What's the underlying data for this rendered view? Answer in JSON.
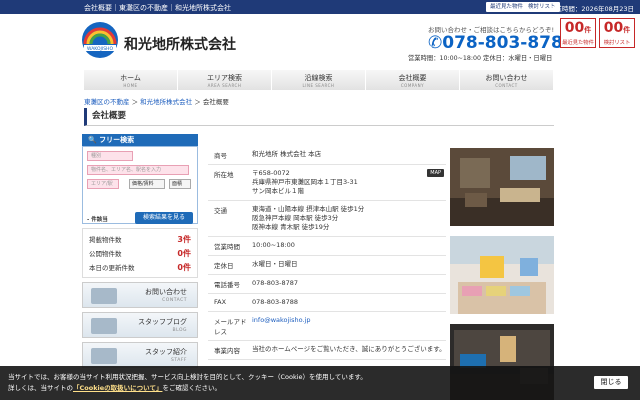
{
  "topbar": {
    "crumbs": "会社概要｜東灘区の不動産｜和光地所株式会社",
    "recent_btn": "最近見た物件",
    "compare_btn": "検討リスト",
    "date": "営業時間：2026年08月23日"
  },
  "header": {
    "company": "和光地所株式会社",
    "logo_text": "WAKOJISHO",
    "contact_msg": "お問い合わせ・ご相談はこちらからどうぞ!",
    "phone": "078-803-8787",
    "hours": "営業時間：10:00~18:00 定休日：水曜日・日曜日",
    "counters": [
      {
        "num": "00",
        "unit": "件",
        "label": "最近見た物件"
      },
      {
        "num": "00",
        "unit": "件",
        "label": "検討リスト"
      }
    ]
  },
  "nav": [
    {
      "jp": "ホーム",
      "en": "HOME"
    },
    {
      "jp": "エリア検索",
      "en": "AREA SEARCH"
    },
    {
      "jp": "沿線検索",
      "en": "LINE SEARCH"
    },
    {
      "jp": "会社概要",
      "en": "COMPANY"
    },
    {
      "jp": "お問い合わせ",
      "en": "CONTACT"
    }
  ],
  "breadcrumb": {
    "item1": "東灘区の不動産",
    "sep": "＞",
    "item2": "和光地所株式会社",
    "current": "会社概要"
  },
  "page_title": "会社概要",
  "sidebar": {
    "search_title": "フリー検索",
    "field1": "種別",
    "field2": "物件名、エリア名、駅名を入力",
    "field3": "エリア/駅",
    "select1": "価格/賃料",
    "select2": "面積",
    "count_label": "件該当",
    "search_btn": "検索結果を見る",
    "stats": [
      {
        "label": "掲載物件数",
        "value": "3件"
      },
      {
        "label": "公開物件数",
        "value": "0件"
      },
      {
        "label": "本日の更新件数",
        "value": "0件"
      }
    ],
    "banners": [
      {
        "jp": "お問い合わせ",
        "en": "CONTACT"
      },
      {
        "jp": "スタッフブログ",
        "en": "BLOG"
      },
      {
        "jp": "スタッフ紹介",
        "en": "STAFF"
      }
    ]
  },
  "company_table": [
    {
      "key": "商号",
      "value": "和光地所 株式会社 本店"
    },
    {
      "key": "所在地",
      "value": "〒658-0072\n兵庫県神戸市東灘区岡本１丁目3-31\nサン岡本ビル１階",
      "map": "MAP"
    },
    {
      "key": "交通",
      "value": "東海道・山陽本線 摂津本山駅 徒歩1分\n阪急神戸本線 岡本駅 徒歩3分\n阪神本線 青木駅 徒歩19分"
    },
    {
      "key": "営業時間",
      "value": "10:00~18:00"
    },
    {
      "key": "定休日",
      "value": "水曜日・日曜日"
    },
    {
      "key": "電話番号",
      "value": "078-803-8787"
    },
    {
      "key": "FAX",
      "value": "078-803-8788"
    },
    {
      "key": "メールアドレス",
      "value": "info@wakojisho.jp",
      "link": true
    },
    {
      "key": "事業内容",
      "value": "当社のホームページをご覧いただき、誠にありがとうございます。"
    }
  ],
  "cookie": {
    "msg1": "当サイトでは、お客様の当サイト利用状況把握、サービス向上検討を目的として、クッキー（Cookie）を使用しています。",
    "msg2_prefix": "詳しくは、当サイトの",
    "msg2_link": "「Cookieの取扱いについて」",
    "msg2_suffix": "をご確認ください。",
    "close": "閉じる"
  }
}
